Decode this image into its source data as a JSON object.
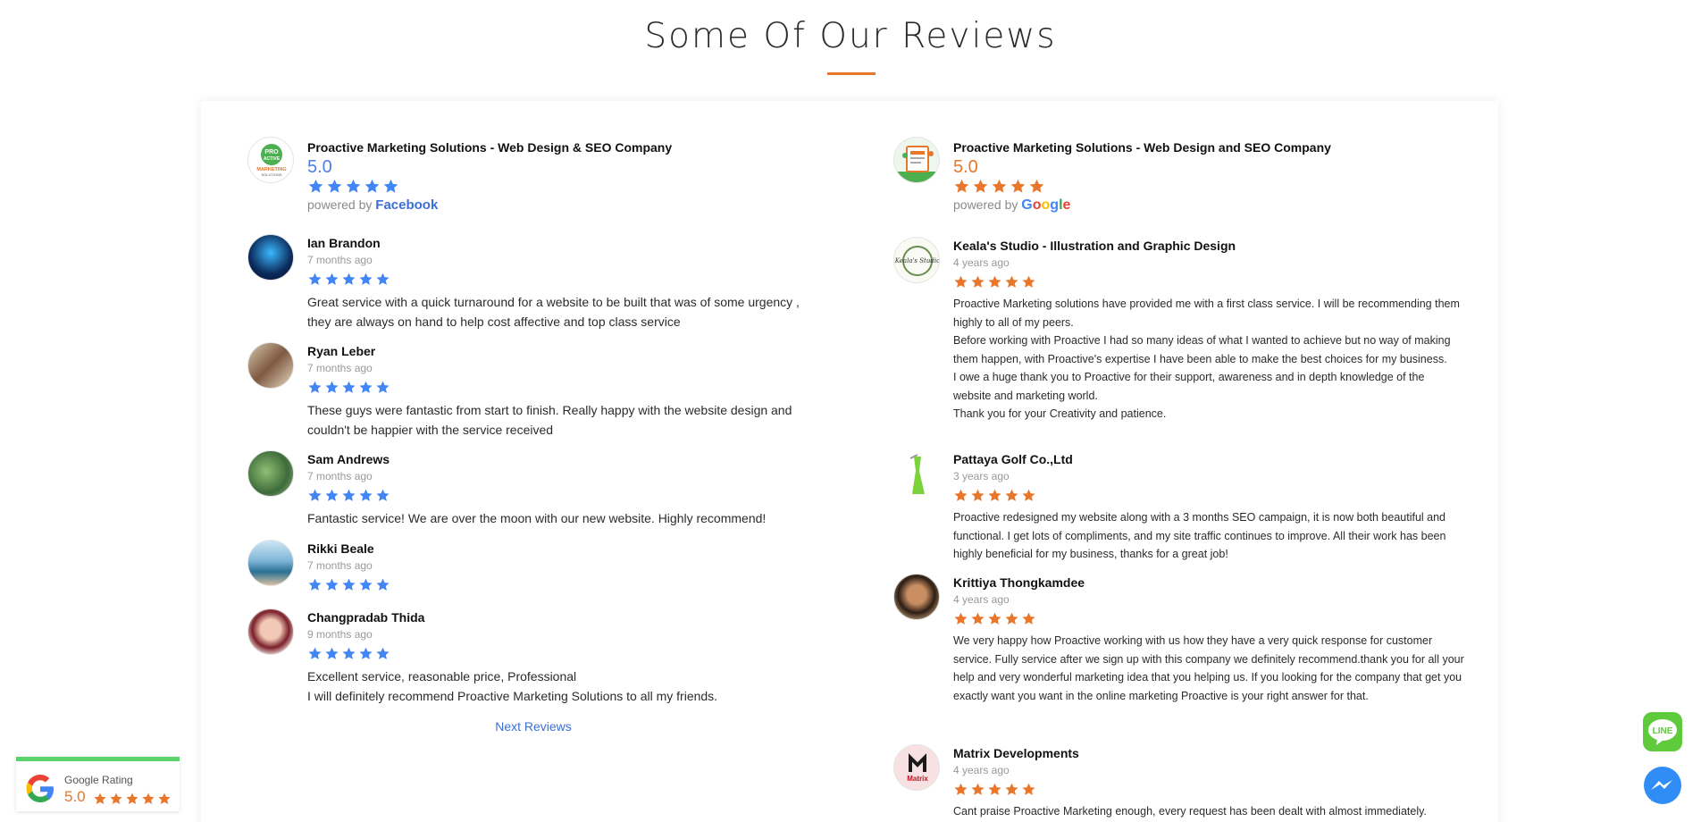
{
  "page": {
    "heading": "Some Of Our Reviews"
  },
  "colors": {
    "accent": "#e8762b",
    "facebook_blue": "#4f7ee8",
    "star_blue": "#4285f4",
    "star_orange": "#e8762b",
    "badge_green": "#5bd16b"
  },
  "facebook_widget": {
    "business_name": "Proactive Marketing Solutions - Web Design & SEO Company",
    "logo_text": "PRO ACTIVE MARKETING SOLUTIONS",
    "rating": "5.0",
    "rating_value": 5,
    "powered_by_prefix": "powered by",
    "powered_by_brand": "Facebook",
    "next_link": "Next Reviews",
    "reviews": [
      {
        "name": "Ian Brandon",
        "time": "7 months ago",
        "stars": 5,
        "text": "Great service with a quick turnaround for a website to be built that was of some urgency , they are always on hand to help cost affective and top class service"
      },
      {
        "name": "Ryan Leber",
        "time": "7 months ago",
        "stars": 5,
        "text": "These guys were fantastic from start to finish. Really happy with the website design and couldn't be happier with the service received"
      },
      {
        "name": "Sam Andrews",
        "time": "7 months ago",
        "stars": 5,
        "text": "Fantastic service! We are over the moon with our new website.  Highly recommend!"
      },
      {
        "name": "Rikki Beale",
        "time": "7 months ago",
        "stars": 5,
        "text": ""
      },
      {
        "name": "Changpradab Thida",
        "time": "9 months ago",
        "stars": 5,
        "text": "Excellent service, reasonable price, Professional\nI will definitely recommend Proactive Marketing Solutions to all my friends."
      }
    ]
  },
  "google_widget": {
    "business_name": "Proactive Marketing Solutions - Web Design and SEO Company",
    "rating": "5.0",
    "rating_value": 5,
    "powered_by_prefix": "powered by",
    "powered_by_brand": "Google",
    "reviews": [
      {
        "name": "Keala's Studio - Illustration and Graphic Design",
        "avatar_text": "Keala's Studio",
        "time": "4 years ago",
        "stars": 5,
        "text": "Proactive Marketing solutions have provided me with a first class service. I will be recommending them highly to all of my peers.\nBefore working with Proactive I had so many ideas of what I wanted to achieve but no way of making them happen, with Proactive's expertise I have been able to make the best choices for my business.\nI owe a huge thank you to Proactive for their support, awareness and in depth knowledge of the website and marketing world.\nThank you for your Creativity and patience."
      },
      {
        "name": "Pattaya Golf Co.,Ltd",
        "time": "3 years ago",
        "stars": 5,
        "text": "Proactive redesigned my website along with a 3 months SEO campaign, it is now both beautiful and functional. I get lots of compliments, and my site traffic continues to improve. All their work has been highly beneficial for my business, thanks for a great job!"
      },
      {
        "name": "Krittiya Thongkamdee",
        "time": "4 years ago",
        "stars": 5,
        "text": "We  very happy  how Proactive working with us how they have a very quick response for customer service. Fully service after we sign up with this company we definitely recommend.thank you for all your help and very wonderful marketing idea that you helping us. If you looking for the company that get you exactly want you want in the online marketing Proactive is your right answer for that."
      },
      {
        "name": "Matrix Developments",
        "avatar_text": "Matrix",
        "time": "4 years ago",
        "stars": 5,
        "text": "Cant praise Proactive Marketing enough, every request has been dealt with almost immediately."
      }
    ]
  },
  "rating_badge": {
    "label": "Google Rating",
    "score": "5.0",
    "stars": 5
  },
  "floating_buttons": [
    {
      "name": "line-chat",
      "icon": "line-icon",
      "label": "LINE"
    },
    {
      "name": "messenger-chat",
      "icon": "messenger-icon"
    }
  ]
}
